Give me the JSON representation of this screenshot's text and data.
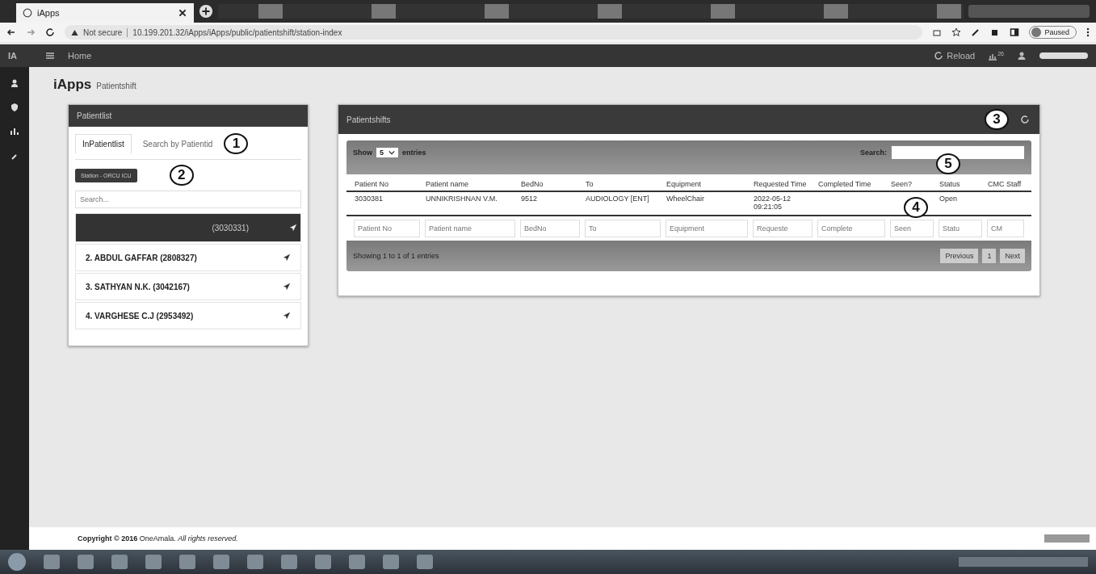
{
  "browser": {
    "tab_title": "iApps",
    "security": "Not secure",
    "url": "10.199.201.32/iApps/iApps/public/patientshift/station-index",
    "profile": "Paused"
  },
  "navbar": {
    "brand": "IA",
    "home": "Home",
    "reload": "Reload",
    "notification_count": "26"
  },
  "page": {
    "title": "iApps",
    "subtitle": "Patientshift"
  },
  "patient_panel": {
    "title": "Patientlist",
    "tabs": [
      {
        "label": "InPatientlist",
        "selected": true
      },
      {
        "label": "Search by Patientid",
        "selected": false
      }
    ],
    "station": "Station - ORCU ICU",
    "search_placeholder": "Search...",
    "patients": [
      {
        "label": "(3030331)",
        "selected": true
      },
      {
        "label": "2. ABDUL GAFFAR (2808327)",
        "selected": false
      },
      {
        "label": "3. SATHYAN N.K. (3042167)",
        "selected": false
      },
      {
        "label": "4. VARGHESE C.J (2953492)",
        "selected": false
      }
    ]
  },
  "shift_panel": {
    "title": "Patientshifts",
    "show": "Show",
    "page_size": "5",
    "entries": "entries",
    "search_label": "Search:",
    "columns": [
      "Patient No",
      "Patient name",
      "BedNo",
      "To",
      "Equipment",
      "Requested Time",
      "Completed Time",
      "Seen?",
      "Status",
      "CMC Staff"
    ],
    "rows": [
      [
        "3030381",
        "UNNIKRISHNAN V.M.",
        "9512",
        "AUDIOLOGY [ENT]",
        "WheelChair",
        "2022-05-12 09:21:05",
        "",
        "",
        "Open",
        ""
      ]
    ],
    "filters": [
      {
        "placeholder": "Patient No"
      },
      {
        "placeholder": "Patient name"
      },
      {
        "placeholder": "BedNo"
      },
      {
        "placeholder": "To"
      },
      {
        "placeholder": "Equipment"
      },
      {
        "placeholder": "Requeste"
      },
      {
        "placeholder": "Complete"
      },
      {
        "placeholder": "Seen"
      },
      {
        "placeholder": "Statu"
      },
      {
        "placeholder": "CM"
      }
    ],
    "info": "Showing 1 to 1 of 1 entries",
    "pages": [
      "Previous",
      "1",
      "Next"
    ]
  },
  "annotations": [
    "1",
    "2",
    "3",
    "4",
    "5"
  ],
  "footer": "**Copyright © 2016** OneAmala. *All rights reserved.*"
}
